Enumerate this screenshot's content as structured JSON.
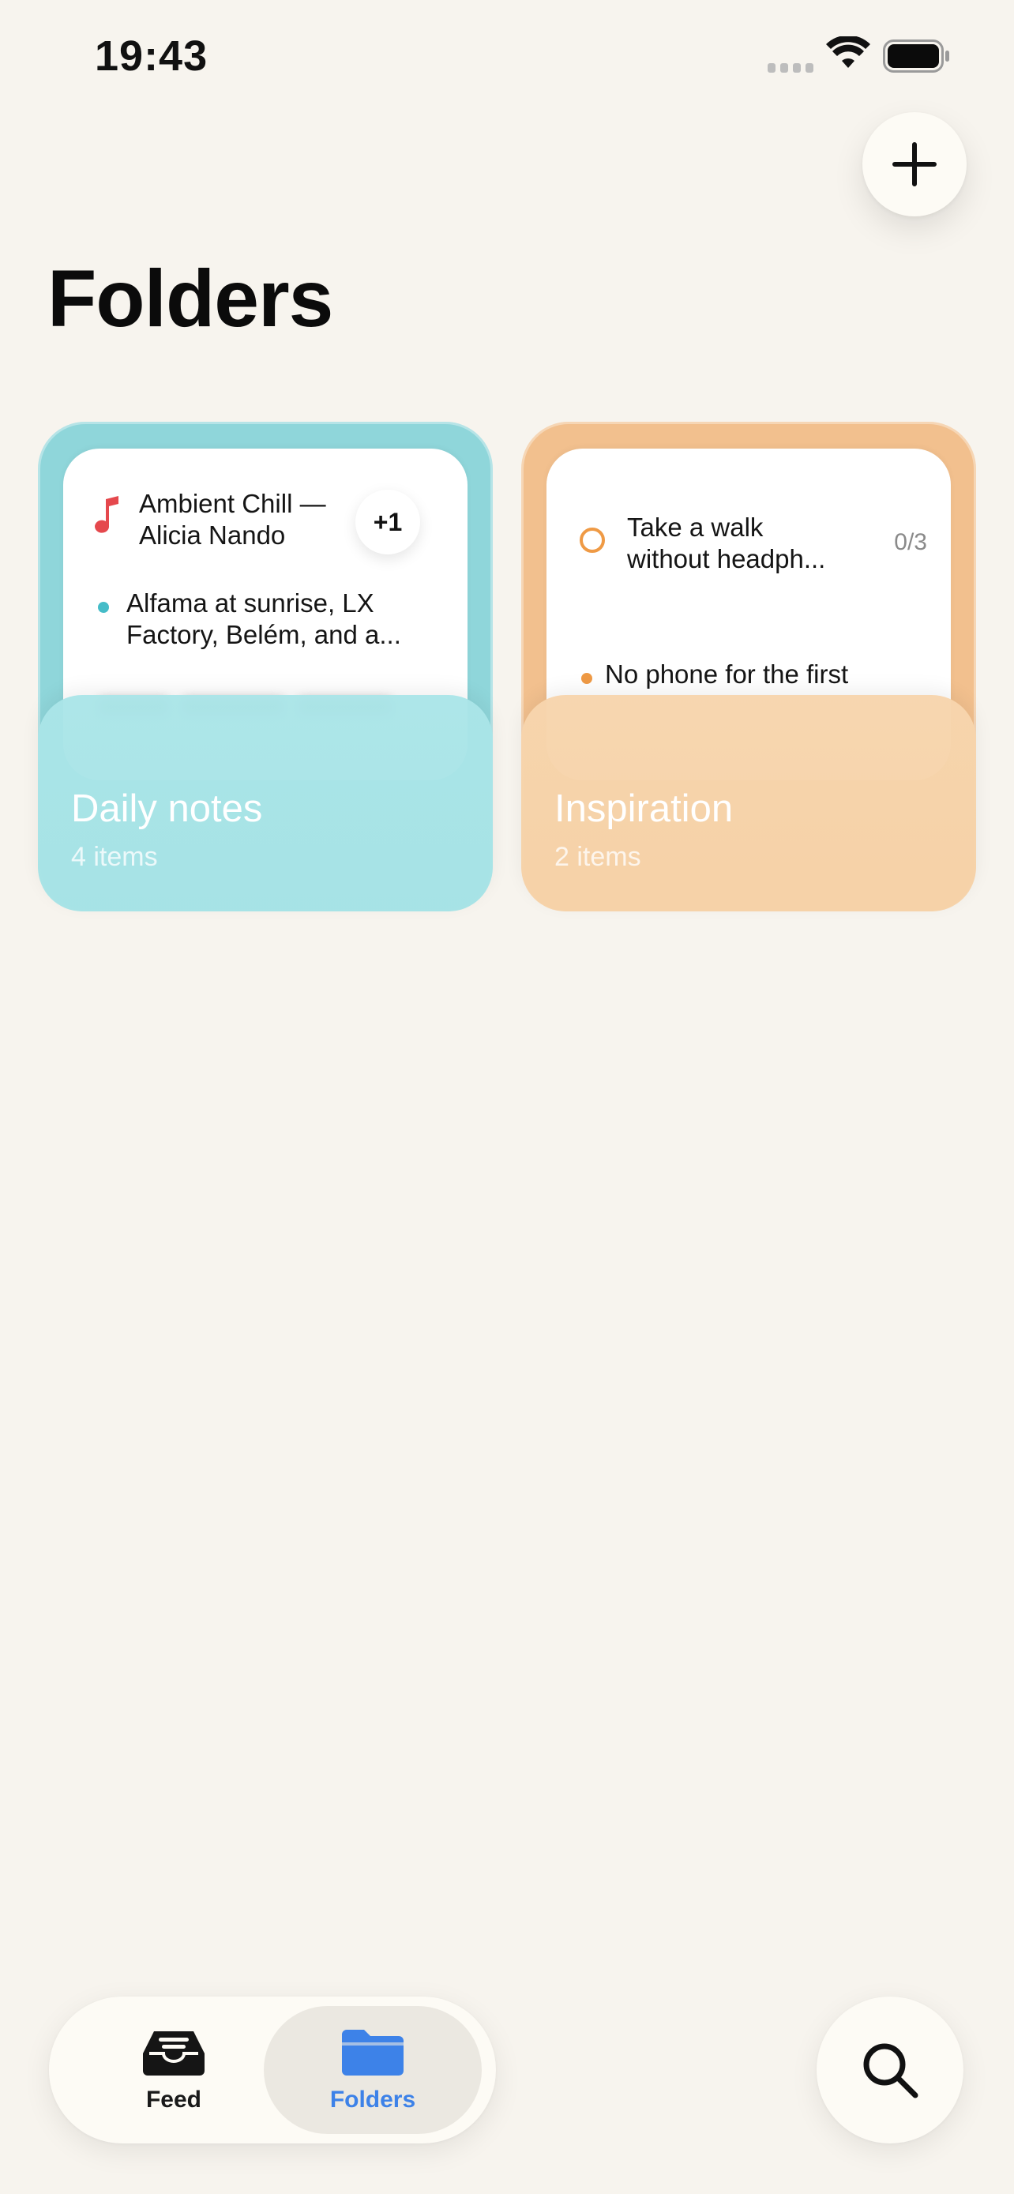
{
  "status_bar": {
    "time": "19:43",
    "icons": [
      "cell-signal-icon",
      "wifi-icon",
      "battery-icon"
    ]
  },
  "header": {
    "title": "Folders",
    "add_icon": "plus-icon"
  },
  "folders": [
    {
      "name": "Daily notes",
      "count": "4 items",
      "color": "#8fd6da",
      "preview": {
        "music_line1": "Ambient Chill —",
        "music_line2": "Alicia Nando",
        "badge": "+1",
        "note_line1": "Alfama at sunrise, LX",
        "note_line2": "Factory, Belém, and a..."
      }
    },
    {
      "name": "Inspiration",
      "count": "2 items",
      "color": "#f2c08e",
      "preview": {
        "task_line1": "Take a walk",
        "task_line2": "without headph...",
        "progress": "0/3",
        "task2_line1": "No phone for the first"
      }
    }
  ],
  "tab_bar": {
    "tabs": [
      {
        "label": "Feed",
        "icon": "inbox-tray-icon",
        "selected": false
      },
      {
        "label": "Folders",
        "icon": "folder-icon",
        "selected": true
      }
    ]
  },
  "search": {
    "icon": "search-icon"
  },
  "colors": {
    "background": "#f7f4ee",
    "accent": "#3d82e8",
    "music": "#e5484d",
    "task": "#ef9a45",
    "note_dot": "#45bcc8"
  }
}
